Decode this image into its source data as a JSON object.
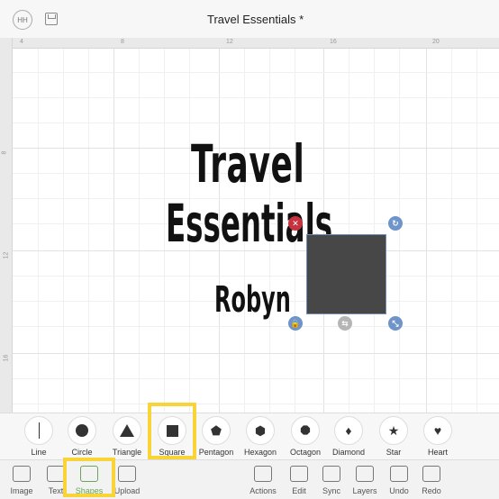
{
  "header": {
    "avatar": "HH",
    "title": "Travel Essentials *"
  },
  "ruler": {
    "top": [
      "4",
      "8",
      "12",
      "16",
      "20"
    ],
    "left": [
      "8",
      "12",
      "16"
    ]
  },
  "canvas": {
    "lines": [
      "Travel",
      "Essentials",
      "Robyn"
    ]
  },
  "shapes": [
    {
      "label": "Line",
      "icon": "line-icon",
      "glyph": "line"
    },
    {
      "label": "Circle",
      "icon": "circle-icon",
      "glyph": "circle"
    },
    {
      "label": "Triangle",
      "icon": "triangle-icon",
      "glyph": "triangle"
    },
    {
      "label": "Square",
      "icon": "square-icon",
      "glyph": "square"
    },
    {
      "label": "Pentagon",
      "icon": "pentagon-icon",
      "glyph": "⬟"
    },
    {
      "label": "Hexagon",
      "icon": "hexagon-icon",
      "glyph": "⬢"
    },
    {
      "label": "Octagon",
      "icon": "octagon-icon",
      "glyph": "⯃"
    },
    {
      "label": "Diamond",
      "icon": "diamond-icon",
      "glyph": "♦"
    },
    {
      "label": "Star",
      "icon": "star-icon",
      "glyph": "★"
    },
    {
      "label": "Heart",
      "icon": "heart-icon",
      "glyph": "♥"
    }
  ],
  "toolbar": {
    "left": [
      "Image",
      "Text",
      "Shapes",
      "Upload"
    ],
    "right": [
      "Actions",
      "Edit",
      "Sync",
      "Layers",
      "Undo",
      "Redo"
    ]
  },
  "colors": {
    "highlight": "#f8d439",
    "active": "#6aa84f",
    "shape_fill": "#474747"
  }
}
